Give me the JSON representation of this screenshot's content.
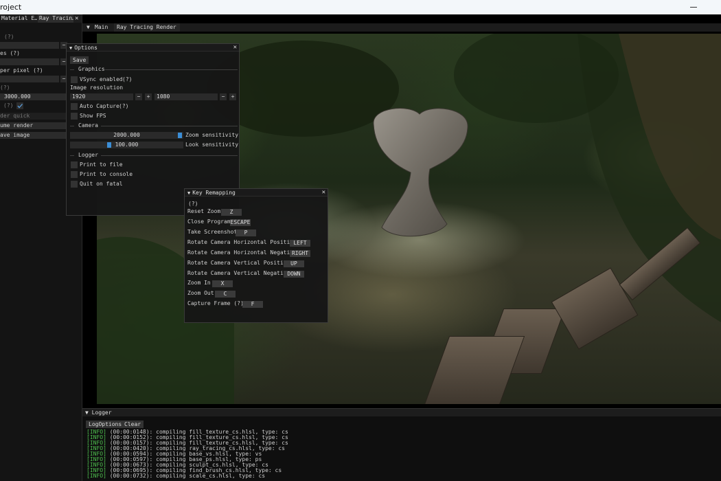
{
  "window": {
    "title": "roject"
  },
  "left_panel": {
    "tabs": [
      {
        "label": "Material E…"
      },
      {
        "label": "Ray Tracin…"
      }
    ],
    "tab_close": "✕",
    "rows": [
      {
        "label": "(?)"
      },
      {
        "label": "es (?)"
      },
      {
        "label": "per pixel (?)"
      },
      {
        "label": "(?)"
      },
      {
        "label": "3000.000"
      },
      {
        "label": "(?)"
      },
      {
        "label": "der quick"
      },
      {
        "label": "ume render"
      },
      {
        "label": "ave image"
      }
    ],
    "minus": "−"
  },
  "viewport": {
    "tabs": [
      {
        "label": "▼"
      },
      {
        "label": "Main"
      },
      {
        "label": "Ray Tracing Render"
      }
    ]
  },
  "options": {
    "title": "Options",
    "close": "✕",
    "save_label": "Save",
    "graphics": {
      "header": "Graphics",
      "vsync_label": "VSync enabled",
      "help": "(?)",
      "resolution_label": "Image resolution",
      "width": "1920",
      "height": "1080",
      "minus": "−",
      "plus": "+",
      "auto_capture_label": "Auto Capture",
      "show_fps_label": "Show FPS"
    },
    "camera": {
      "header": "Camera",
      "zoom_value": "2000.000",
      "zoom_label": "Zoom sensitivity",
      "zoom_fraction": 0.99,
      "look_value": "100.000",
      "look_label": "Look sensitivity",
      "look_fraction": 0.34
    },
    "logger": {
      "header": "Logger",
      "print_file_label": "Print to file",
      "print_console_label": "Print to console",
      "quit_fatal_label": "Quit on fatal"
    }
  },
  "key_remap": {
    "title": "Key Remapping",
    "close": "✕",
    "help": "(?)",
    "items": [
      {
        "label": "Reset Zoom",
        "key": "Z"
      },
      {
        "label": "Close Program",
        "key": "ESCAPE"
      },
      {
        "label": "Take Screenshot",
        "key": "P"
      },
      {
        "label": "Rotate Camera Horizontal Positive",
        "key": "LEFT"
      },
      {
        "label": "Rotate Camera Horizontal Negative",
        "key": "RIGHT"
      },
      {
        "label": "Rotate Camera Vertical Positive",
        "key": "UP"
      },
      {
        "label": "Rotate Camera Vertical Negative",
        "key": "DOWN"
      },
      {
        "label": "Zoom In",
        "key": "X"
      },
      {
        "label": "Zoom Out",
        "key": "C"
      },
      {
        "label": "Capture Frame (?)",
        "key": "F"
      }
    ]
  },
  "logger": {
    "title": "Logger",
    "options_label": "LogOptions",
    "clear_label": "Clear",
    "lines": [
      {
        "tag": "[INFO]",
        "text": " (00:00:0148): compiling fill_texture_cs.hlsl, type: cs"
      },
      {
        "tag": "[INFO]",
        "text": " (00:00:0152): compiling fill_texture_cs.hlsl, type: cs"
      },
      {
        "tag": "[INFO]",
        "text": " (00:00:0157): compiling fill_texture_cs.hlsl, type: cs"
      },
      {
        "tag": "[INFO]",
        "text": " (00:00:0420): compiling ray_tracing_cs.hlsl, type: cs"
      },
      {
        "tag": "[INFO]",
        "text": " (00:00:0594): compiling base_vs.hlsl, type: vs"
      },
      {
        "tag": "[INFO]",
        "text": " (00:00:0597): compiling base_ps.hlsl, type: ps"
      },
      {
        "tag": "[INFO]",
        "text": " (00:00:0673): compiling sculpt_cs.hlsl, type: cs"
      },
      {
        "tag": "[INFO]",
        "text": " (00:00:0695): compiling find_brush_cs.hlsl, type: cs"
      },
      {
        "tag": "[INFO]",
        "text": " (00:00:0732): compiling scale_cs.hlsl, type: cs"
      }
    ]
  }
}
